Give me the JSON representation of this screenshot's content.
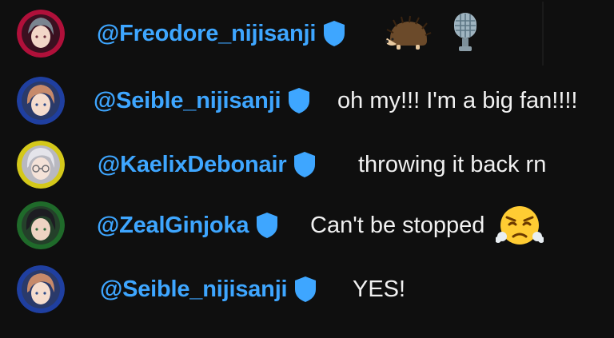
{
  "messages": [
    {
      "author": "@Freodore_nijisanji",
      "text": "",
      "emojis": [
        "hedgehog-emoji",
        "microphone-emoji"
      ],
      "avatar": {
        "bg": "#b0103a",
        "hair": "#7a8590",
        "skin": "#f2d6c8"
      }
    },
    {
      "author": "@Seible_nijisanji",
      "text": "oh my!!! I'm a big fan!!!!",
      "emojis": [],
      "avatar": {
        "bg": "#1f3fa0",
        "hair": "#c78a6a",
        "skin": "#f5dccd"
      }
    },
    {
      "author": "@KaelixDebonair",
      "text": "throwing it back rn",
      "emojis": [],
      "avatar": {
        "bg": "#d4c81a",
        "hair": "#e4e4ea",
        "skin": "#f4e2d8"
      }
    },
    {
      "author": "@ZealGinjoka",
      "text": "Can't be stopped",
      "emojis": [
        "face-with-steam-emoji"
      ],
      "avatar": {
        "bg": "#1f6a2a",
        "hair": "#1d1d22",
        "skin": "#eed3c2"
      }
    },
    {
      "author": "@Seible_nijisanji",
      "text": "YES!",
      "emojis": [],
      "avatar": {
        "bg": "#1f3fa0",
        "hair": "#c78a6a",
        "skin": "#f5dccd"
      }
    }
  ],
  "colors": {
    "background": "#0f0f0f",
    "author": "#3ea6ff",
    "message": "#f1f1f1",
    "verified": "#3ea6ff"
  }
}
